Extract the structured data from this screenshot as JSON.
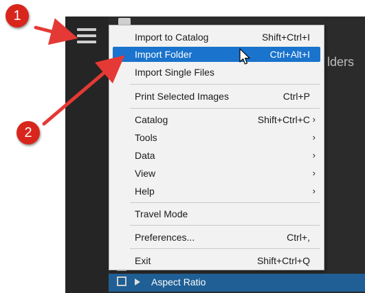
{
  "header": {
    "partial_title": "lders"
  },
  "menu": {
    "items": [
      {
        "label": "Import to Catalog",
        "shortcut": "Shift+Ctrl+I"
      },
      {
        "label": "Import Folder",
        "shortcut": "Ctrl+Alt+I",
        "highlighted": true
      },
      {
        "label": "Import Single Files",
        "shortcut": ""
      },
      {
        "label": "Print Selected Images",
        "shortcut": "Ctrl+P"
      },
      {
        "label": "Catalog",
        "shortcut": "Shift+Ctrl+C",
        "submenu": true
      },
      {
        "label": "Tools",
        "shortcut": "",
        "submenu": true
      },
      {
        "label": "Data",
        "shortcut": "",
        "submenu": true
      },
      {
        "label": "View",
        "shortcut": "",
        "submenu": true
      },
      {
        "label": "Help",
        "shortcut": "",
        "submenu": true
      },
      {
        "label": "Travel Mode",
        "shortcut": ""
      },
      {
        "label": "Preferences...",
        "shortcut": "Ctrl+,"
      },
      {
        "label": "Exit",
        "shortcut": "Shift+Ctrl+Q"
      }
    ],
    "submenu_arrow": "›"
  },
  "filter_panel": {
    "aspect_ratio_label": "Aspect Ratio"
  },
  "annotations": {
    "badge_1": "1",
    "badge_2": "2"
  },
  "colors": {
    "highlight": "#1a73cc",
    "badge": "#d8261c",
    "arrow": "#e53935",
    "panel_bar": "#1f5f95"
  },
  "icons": [
    "hamburger-menu-icon",
    "mouse-cursor-icon",
    "edit-icon",
    "expand-triangle-icon"
  ]
}
